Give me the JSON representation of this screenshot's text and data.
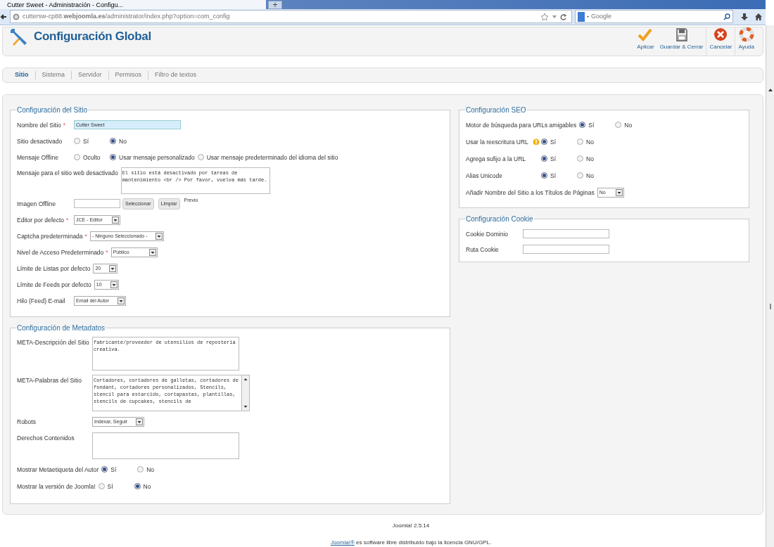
{
  "browser": {
    "tab_title": "Cutter Sweet - Administración - Configu...",
    "new_tab": "+",
    "url": "cuttersw-cp88.**webjoomla.es**/administrator/index.php?option=com_config",
    "search_placeholder": "Google"
  },
  "header": {
    "title": "Configuración Global",
    "toolbar": [
      {
        "label": "Aplicar"
      },
      {
        "label": "Guardar & Cerrar"
      },
      {
        "label": "Cancelar"
      },
      {
        "label": "Ayuda"
      }
    ]
  },
  "tabs": [
    {
      "label": "Sitio",
      "selected": true
    },
    {
      "label": "Sistema",
      "selected": false
    },
    {
      "label": "Servidor",
      "selected": false
    },
    {
      "label": "Permisos",
      "selected": false
    },
    {
      "label": "Filtro de textos",
      "selected": false
    }
  ],
  "columns": [
    [
      {
        "legend": "Configuración del Sitio",
        "rows": [
          {
            "kind": "text",
            "label": "Nombre del Sitio",
            "mark": "*",
            "value": "Cutter Sweet",
            "highlighted": true
          },
          {
            "kind": "radio",
            "label": "Sitio desactivado",
            "options": [
              {
                "label": "Sí",
                "selected": false
              },
              {
                "label": "No",
                "selected": true
              }
            ]
          },
          {
            "kind": "radio",
            "label": "Mensaje Offline",
            "options": [
              {
                "label": "Oculto",
                "selected": false
              },
              {
                "label": "Usar mensaje personalizado",
                "selected": true
              },
              {
                "label": "Usar mensaje predeterminado del idioma del sitio",
                "selected": false
              }
            ]
          },
          {
            "kind": "textarea",
            "label": "Mensaje para el sitio web desactivado",
            "value": "El sitio está desactivado por tareas de mantenimiento <br /> Por favor, vuelva más tarde."
          },
          {
            "kind": "image",
            "label": "Imagen Offline",
            "buttons": [
              "Seleccionar",
              "Limpiar"
            ],
            "preview": "Previo"
          },
          {
            "kind": "select",
            "label": "Editor por defecto",
            "mark": "*",
            "value": "JCE - Editor"
          },
          {
            "kind": "select",
            "label": "Captcha predeterminada",
            "mark": "*",
            "value": "- Ninguno Seleccionado -"
          },
          {
            "kind": "select",
            "label": "Nivel de Acceso Predeterminado",
            "mark": "*",
            "value": "Público"
          },
          {
            "kind": "select",
            "label": "Límite de Listas por defecto",
            "value": "20"
          },
          {
            "kind": "select",
            "label": "Límite de Feeds por defecto",
            "value": "10"
          },
          {
            "kind": "select",
            "label": "Hilo (Feed) E-mail",
            "value": "Email del Autor"
          }
        ]
      },
      {
        "legend": "Configuración de Metadatos",
        "rows": [
          {
            "kind": "textarea",
            "label": "META-Descripción del Sitio",
            "value": "fabricante/proveedor de utensilios de reposteria creativa."
          },
          {
            "kind": "textarea",
            "label": "META-Palabras del Sitio",
            "value": "Cortadores, cortadores de galletas, cortadores de fondant, cortadores personalizados, Stencils, stencil para estarcido, cortapastas, plantillas, stencils de cupcakes, stencils de",
            "scrollable": true
          },
          {
            "kind": "select",
            "label": "Robots",
            "value": "Indexar, Seguir"
          },
          {
            "kind": "textarea",
            "label": "Derechos Contenidos",
            "value": ""
          },
          {
            "kind": "radio",
            "label": "Mostrar Metaetiqueta del Autor",
            "options": [
              {
                "label": "Sí",
                "selected": true
              },
              {
                "label": "No",
                "selected": false
              }
            ]
          },
          {
            "kind": "radio",
            "label": "Mostrar la versión de Joomla!",
            "options": [
              {
                "label": "Sí",
                "selected": false
              },
              {
                "label": "No",
                "selected": true
              }
            ]
          }
        ]
      }
    ],
    [
      {
        "legend": "Configuración SEO",
        "rows": [
          {
            "kind": "radio",
            "label": "Motor de búsqueda para URLs amigables",
            "options": [
              {
                "label": "Sí",
                "selected": true
              },
              {
                "label": "No",
                "selected": false
              }
            ]
          },
          {
            "kind": "radio",
            "label": "Usar la reescritura URL",
            "warning": true,
            "options": [
              {
                "label": "Sí",
                "selected": true
              },
              {
                "label": "No",
                "selected": false
              }
            ]
          },
          {
            "kind": "radio",
            "label": "Agrega sufijo a la URL",
            "options": [
              {
                "label": "Sí",
                "selected": true
              },
              {
                "label": "No",
                "selected": false
              }
            ]
          },
          {
            "kind": "radio",
            "label": "Alias Unicode",
            "options": [
              {
                "label": "Sí",
                "selected": true
              },
              {
                "label": "No",
                "selected": false
              }
            ]
          },
          {
            "kind": "select",
            "label": "Añadir Nombre del Sitio a los Títulos de Páginas",
            "value": "No"
          }
        ]
      },
      {
        "legend": "Configuración Cookie",
        "rows": [
          {
            "kind": "text",
            "label": "Cookie Dominio",
            "value": ""
          },
          {
            "kind": "text",
            "label": "Ruta Cookie",
            "value": ""
          }
        ]
      }
    ]
  ],
  "footer": {
    "version": "Joomla! 2.5.14",
    "license_link": "Joomla!®",
    "license": "es software libre distribuido bajo la licencia GNU/GPL."
  }
}
